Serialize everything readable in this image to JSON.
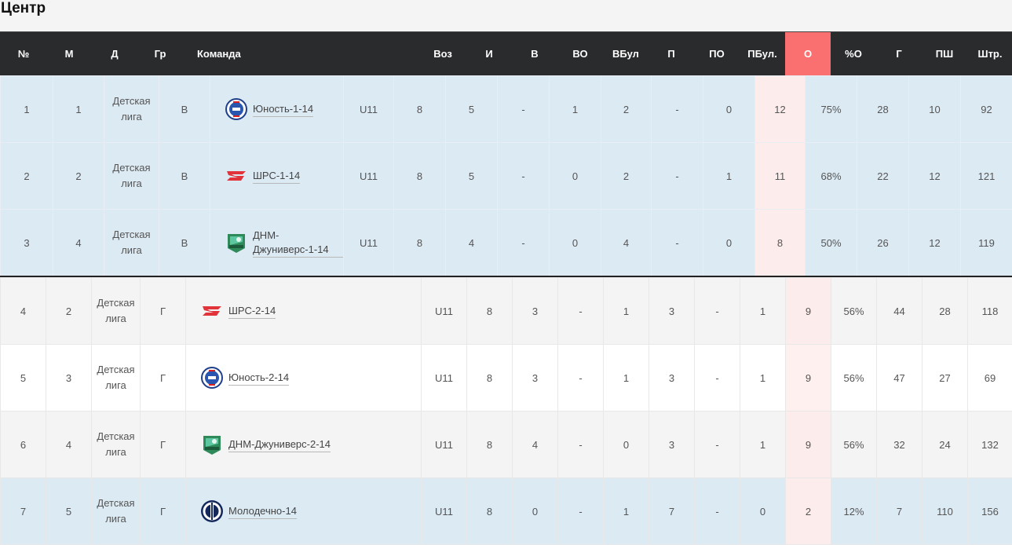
{
  "page_title": "Центр",
  "columns": [
    "№",
    "М",
    "Д",
    "Гр",
    "Команда",
    "Воз",
    "И",
    "В",
    "ВО",
    "ВБул",
    "П",
    "ПО",
    "ПБул.",
    "О",
    "%О",
    "Г",
    "ПШ",
    "Штр."
  ],
  "group_b": [
    {
      "n": "1",
      "m": "1",
      "d": "Детская лига",
      "gr": "В",
      "logo": "yunost-logo",
      "team": "Юность-1-14",
      "age": "U11",
      "games": "8",
      "w": "5",
      "wot": "-",
      "wso": "1",
      "l": "2",
      "lot": "-",
      "lso": "0",
      "pts": "12",
      "pct": "75%",
      "g": "28",
      "ga": "10",
      "pim": "92"
    },
    {
      "n": "2",
      "m": "2",
      "d": "Детская лига",
      "gr": "В",
      "logo": "shrs-logo",
      "team": "ШРС-1-14",
      "age": "U11",
      "games": "8",
      "w": "5",
      "wot": "-",
      "wso": "0",
      "l": "2",
      "lot": "-",
      "lso": "1",
      "pts": "11",
      "pct": "68%",
      "g": "22",
      "ga": "12",
      "pim": "121"
    },
    {
      "n": "3",
      "m": "4",
      "d": "Детская лига",
      "gr": "В",
      "logo": "dnm-logo",
      "team": "ДНМ-Джуниверс-1-14",
      "age": "U11",
      "games": "8",
      "w": "4",
      "wot": "-",
      "wso": "0",
      "l": "4",
      "lot": "-",
      "lso": "0",
      "pts": "8",
      "pct": "50%",
      "g": "26",
      "ga": "12",
      "pim": "119"
    }
  ],
  "group_g": [
    {
      "n": "4",
      "m": "2",
      "d": "Детская лига",
      "gr": "Г",
      "logo": "shrs-logo",
      "team": "ШРС-2-14",
      "age": "U11",
      "games": "8",
      "w": "3",
      "wot": "-",
      "wso": "1",
      "l": "3",
      "lot": "-",
      "lso": "1",
      "pts": "9",
      "pct": "56%",
      "g": "44",
      "ga": "28",
      "pim": "118"
    },
    {
      "n": "5",
      "m": "3",
      "d": "Детская лига",
      "gr": "Г",
      "logo": "yunost-logo",
      "team": "Юность-2-14",
      "age": "U11",
      "games": "8",
      "w": "3",
      "wot": "-",
      "wso": "1",
      "l": "3",
      "lot": "-",
      "lso": "1",
      "pts": "9",
      "pct": "56%",
      "g": "47",
      "ga": "27",
      "pim": "69"
    },
    {
      "n": "6",
      "m": "4",
      "d": "Детская лига",
      "gr": "Г",
      "logo": "dnm-logo",
      "team": "ДНМ-Джуниверс-2-14",
      "age": "U11",
      "games": "8",
      "w": "4",
      "wot": "-",
      "wso": "0",
      "l": "3",
      "lot": "-",
      "lso": "1",
      "pts": "9",
      "pct": "56%",
      "g": "32",
      "ga": "24",
      "pim": "132"
    },
    {
      "n": "7",
      "m": "5",
      "d": "Детская лига",
      "gr": "Г",
      "logo": "molodechno-logo",
      "team": "Молодечно-14",
      "age": "U11",
      "games": "8",
      "w": "0",
      "wot": "-",
      "wso": "1",
      "l": "7",
      "lot": "-",
      "lso": "0",
      "pts": "2",
      "pct": "12%",
      "g": "7",
      "ga": "110",
      "pim": "156"
    }
  ],
  "colors": {
    "header": "#2a2b2d",
    "points_header": "#fa6f6f",
    "row_blue": "#dceaf4",
    "row_gray": "#f4f4f4",
    "points_cell": "#fdecec"
  }
}
